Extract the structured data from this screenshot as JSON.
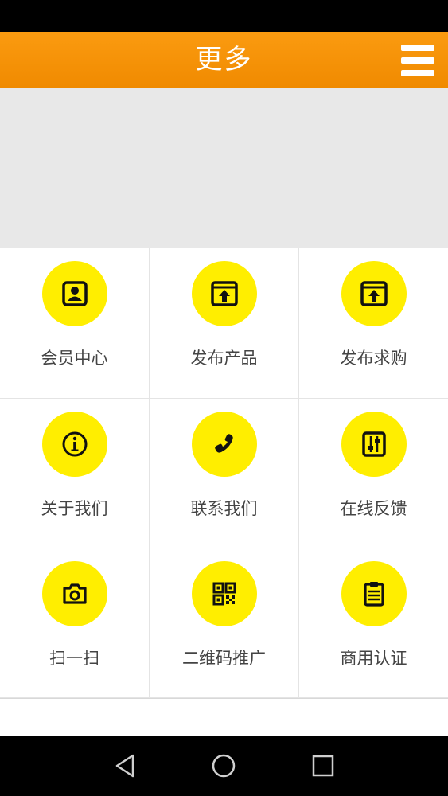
{
  "header": {
    "title": "更多",
    "background": "#f7931e"
  },
  "grid": {
    "icon_color": "#ffee00",
    "items": [
      {
        "label": "会员中心",
        "icon": "member-card-icon"
      },
      {
        "label": "发布产品",
        "icon": "upload-window-icon"
      },
      {
        "label": "发布求购",
        "icon": "upload-window-icon"
      },
      {
        "label": "关于我们",
        "icon": "info-icon"
      },
      {
        "label": "联系我们",
        "icon": "phone-icon"
      },
      {
        "label": "在线反馈",
        "icon": "sliders-icon"
      },
      {
        "label": "扫一扫",
        "icon": "camera-icon"
      },
      {
        "label": "二维码推广",
        "icon": "qr-code-icon"
      },
      {
        "label": "商用认证",
        "icon": "clipboard-icon"
      }
    ]
  },
  "navbar": {
    "back_icon": "back-triangle-icon",
    "home_icon": "home-circle-icon",
    "recents_icon": "recents-square-icon"
  }
}
